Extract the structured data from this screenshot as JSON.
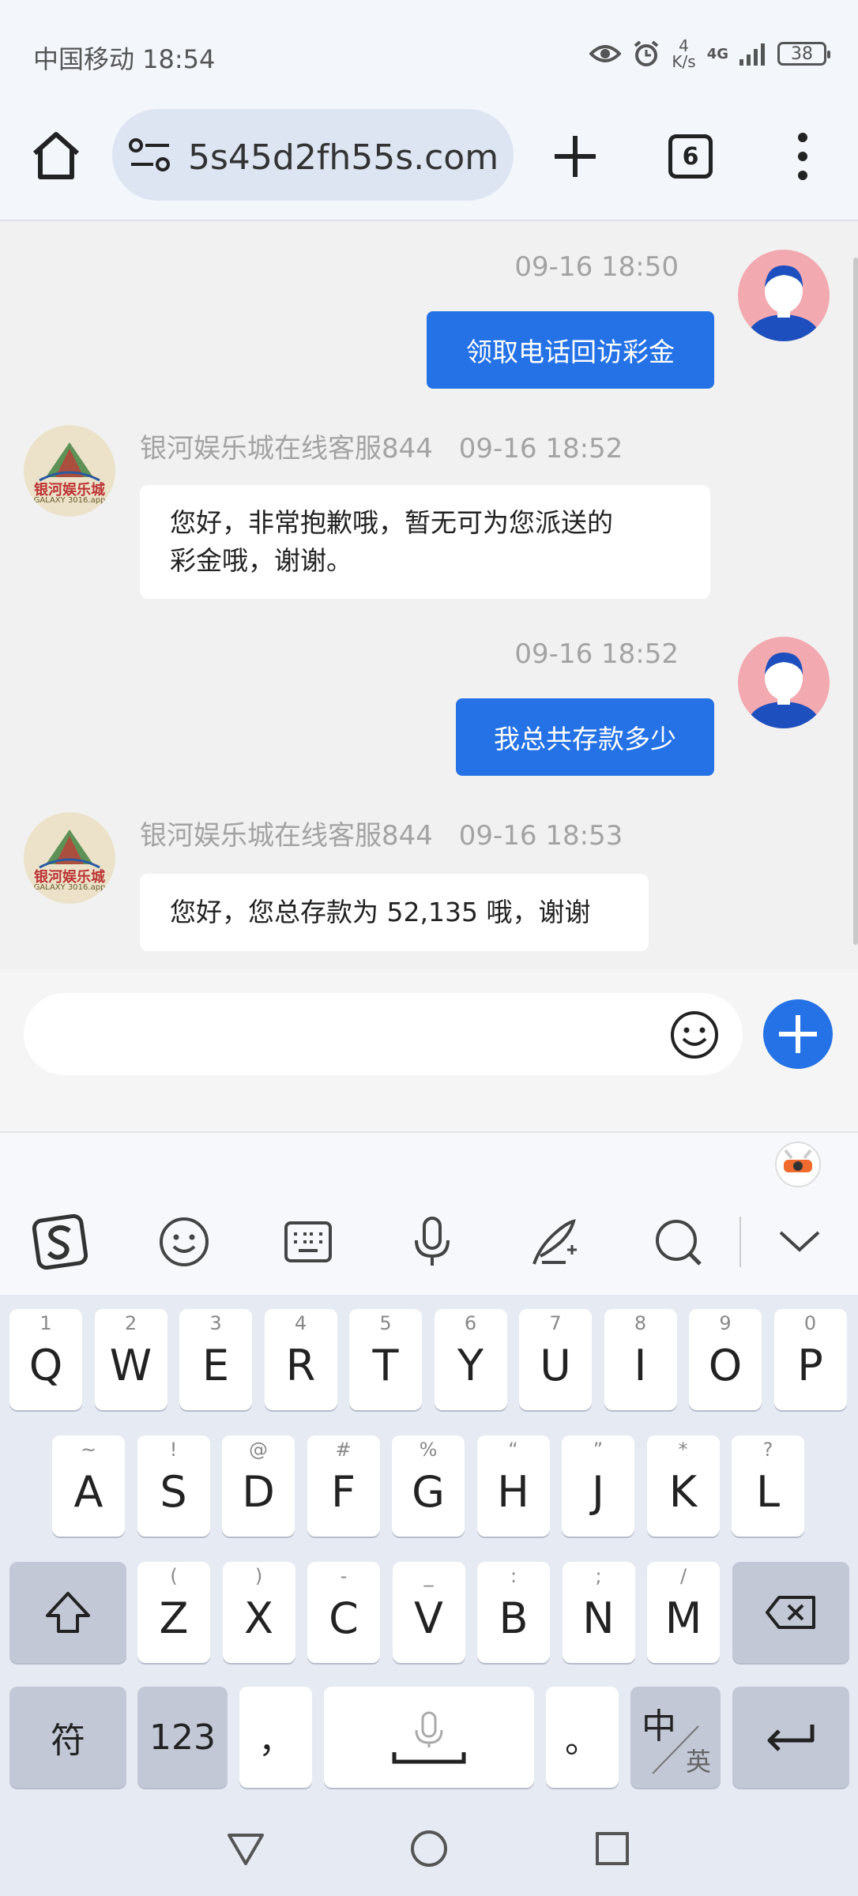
{
  "status_bar": {
    "carrier_time": "中国移动 18:54",
    "net_speed_top": "4",
    "net_speed_unit": "K/s",
    "network": "4G",
    "battery": "38"
  },
  "browser": {
    "url": "5s45d2fh55s.com",
    "tab_count": "6"
  },
  "chat": {
    "messages": [
      {
        "time": "09-16 18:50",
        "text": "领取电话回访彩金"
      },
      {
        "sender": "银河娱乐城在线客服844",
        "time": "09-16 18:52",
        "line1": "您好，非常抱歉哦，暂无可为您派送的",
        "line2": "彩金哦，谢谢。"
      },
      {
        "time": "09-16 18:52",
        "text": "我总共存款多少"
      },
      {
        "sender": "银河娱乐城在线客服844",
        "time": "09-16 18:53",
        "text": "您好，您总存款为 52,135 哦，谢谢"
      }
    ],
    "agent_logo_text": "银河娱乐城",
    "agent_logo_sub": "GALAXY 3016.app"
  },
  "keyboard": {
    "row1": [
      {
        "k": "Q",
        "n": "1"
      },
      {
        "k": "W",
        "n": "2"
      },
      {
        "k": "E",
        "n": "3"
      },
      {
        "k": "R",
        "n": "4"
      },
      {
        "k": "T",
        "n": "5"
      },
      {
        "k": "Y",
        "n": "6"
      },
      {
        "k": "U",
        "n": "7"
      },
      {
        "k": "I",
        "n": "8"
      },
      {
        "k": "O",
        "n": "9"
      },
      {
        "k": "P",
        "n": "0"
      }
    ],
    "row2": [
      {
        "k": "A",
        "n": "~"
      },
      {
        "k": "S",
        "n": "!"
      },
      {
        "k": "D",
        "n": "@"
      },
      {
        "k": "F",
        "n": "#"
      },
      {
        "k": "G",
        "n": "%"
      },
      {
        "k": "H",
        "n": "“"
      },
      {
        "k": "J",
        "n": "”"
      },
      {
        "k": "K",
        "n": "*"
      },
      {
        "k": "L",
        "n": "?"
      }
    ],
    "row3": [
      {
        "k": "Z",
        "n": "("
      },
      {
        "k": "X",
        "n": ")"
      },
      {
        "k": "C",
        "n": "-"
      },
      {
        "k": "V",
        "n": "_"
      },
      {
        "k": "B",
        "n": ":"
      },
      {
        "k": "N",
        "n": ";"
      },
      {
        "k": "M",
        "n": "/"
      }
    ],
    "symbols_key": "符",
    "numbers_key": "123",
    "comma_key": "，",
    "period_key": "。",
    "lang_key_main": "中",
    "lang_key_sub": "英"
  },
  "colors": {
    "accent": "#2472e6",
    "bubble_in": "#ffffff",
    "chat_bg": "#f1f1f1"
  }
}
